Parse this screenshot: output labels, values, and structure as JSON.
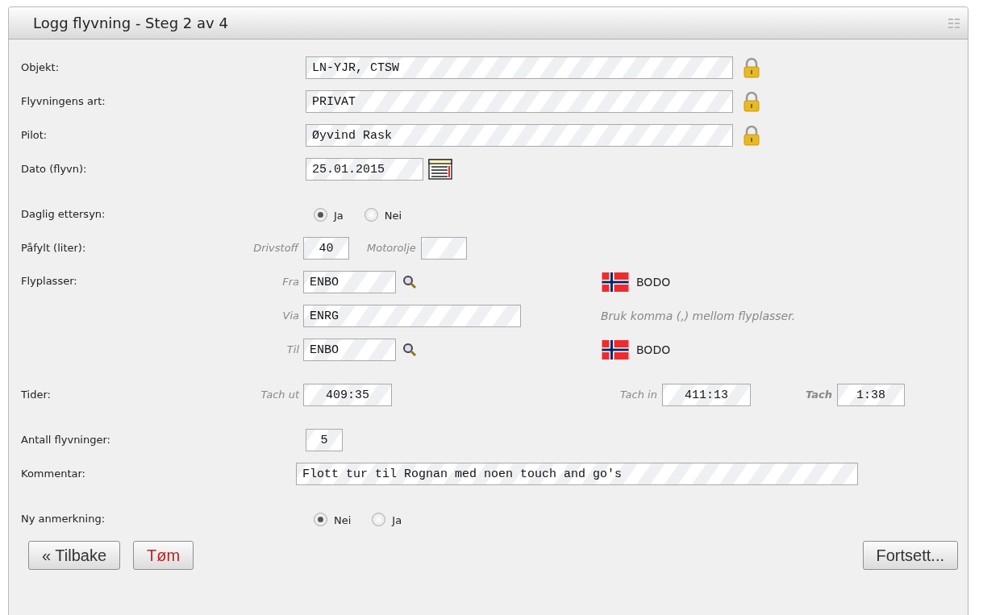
{
  "panel": {
    "title": "Logg flyvning - Steg 2 av 4"
  },
  "fields": [
    {
      "kind": "locked",
      "label": "Objekt:",
      "value": "LN-YJR, CTSW"
    },
    {
      "kind": "locked",
      "label": "Flyvningens art:",
      "value": "PRIVAT"
    },
    {
      "kind": "locked",
      "label": "Pilot:",
      "value": "Øyvind Rask"
    },
    {
      "kind": "date",
      "label": "Dato (flyvn):",
      "value": "25.01.2015"
    },
    {
      "kind": "radio",
      "label": "Daglig ettersyn:",
      "options": [
        {
          "label": "Ja",
          "selected": true
        },
        {
          "label": "Nei",
          "selected": false
        }
      ]
    },
    {
      "kind": "fill",
      "label": "Påfylt (liter):",
      "parts": [
        {
          "label": "Drivstoff",
          "value": "40"
        },
        {
          "label": "Motorolje"
        }
      ]
    },
    {
      "kind": "airports",
      "label": "Flyplasser:",
      "rows": [
        {
          "label": "Fra",
          "value": "ENBO",
          "place": "BODO"
        },
        {
          "label": "Via",
          "value": "ENRG",
          "hint": "Bruk komma (,) mellom flyplasser."
        },
        {
          "label": "Til",
          "value": "ENBO",
          "place": "BODO"
        }
      ]
    },
    {
      "kind": "times",
      "label": "Tider:",
      "parts": [
        {
          "label": "Tach ut",
          "value": "409:35",
          "bold": false
        },
        {
          "label": "Tach in",
          "value": "411:13",
          "bold": false
        },
        {
          "label": "Tach",
          "value": "1:38",
          "bold": true
        }
      ]
    },
    {
      "kind": "short",
      "label": "Antall flyvninger:",
      "value": "5"
    },
    {
      "kind": "wide",
      "label": "Kommentar:",
      "value": "Flott tur til Rognan med noen touch and go's"
    },
    {
      "kind": "radio",
      "label": "Ny anmerkning:",
      "options": [
        {
          "label": "Nei",
          "selected": true
        },
        {
          "label": "Ja",
          "selected": false
        }
      ]
    }
  ],
  "buttons": [
    {
      "kind": "back",
      "label": "« Tilbake"
    },
    {
      "kind": "danger",
      "label": "Tøm"
    },
    {
      "kind": "next",
      "label": "Fortsett..."
    }
  ]
}
